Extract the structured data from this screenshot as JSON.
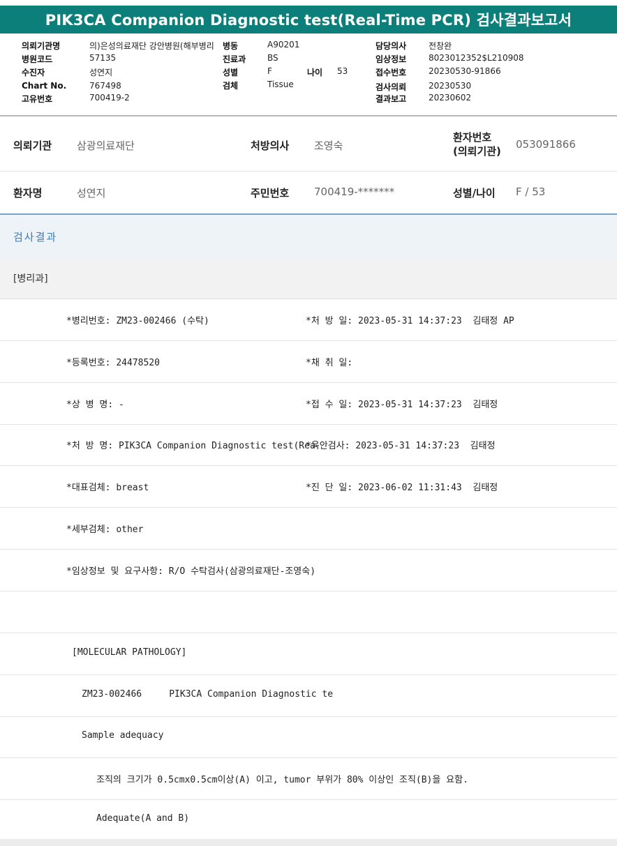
{
  "banner": {
    "title": "PIK3CA Companion Diagnostic test(Real-Time PCR) 검사결과보고서"
  },
  "header": {
    "labels": {
      "institution": "의뢰기관명",
      "hospital_code": "병원코드",
      "patient": "수진자",
      "chart_no": "Chart No.",
      "unique_no": "고유번호",
      "ward": "병동",
      "department": "진료과",
      "sex": "성별",
      "age": "나이",
      "specimen": "검체",
      "doctor": "담당의사",
      "clinical_info": "임상정보",
      "receipt_no": "접수번호",
      "request_date": "검사의뢰",
      "report_date": "결과보고"
    },
    "values": {
      "institution": "의)은성의료재단 강안병원(해부병리",
      "hospital_code": "57135",
      "patient": "성연지",
      "chart_no": "767498",
      "unique_no": "700419-2",
      "ward": "A90201",
      "department": "BS",
      "sex": "F",
      "age": "53",
      "specimen": "Tissue",
      "doctor": "전창완",
      "clinical_info": "8023012352$L210908",
      "receipt_no": "20230530-91866",
      "request_date": "20230530",
      "report_date": "20230602"
    }
  },
  "patient_info": {
    "row1": {
      "inst_label": "의뢰기관",
      "inst_value": "삼광의료재단",
      "doctor_label": "처방의사",
      "doctor_value": "조영숙",
      "pid_label_1": "환자번호",
      "pid_label_2": "(의뢰기관)",
      "pid_value": "053091866"
    },
    "row2": {
      "name_label": "환자명",
      "name_value": "성연지",
      "rrn_label": "주민번호",
      "rrn_value": "700419-*******",
      "sexage_label": "성별/나이",
      "sexage_value": "F / 53"
    }
  },
  "results": {
    "section_title": "검사결과",
    "department": "[병리과]",
    "rows": [
      {
        "left": "*병리번호: ZM23-002466 (수탁)",
        "right": "*처 방 일: 2023-05-31 14:37:23  김태정 AP"
      },
      {
        "left": "*등록번호: 24478520",
        "right": "*채 취 일:"
      },
      {
        "left": "*상 병 명: -",
        "right": "*접 수 일: 2023-05-31 14:37:23  김태정"
      },
      {
        "left": "*처 방 명: PIK3CA Companion Diagnostic test(Rea",
        "right": "*육안검사: 2023-05-31 14:37:23  김태정"
      },
      {
        "left": "*대표검체: breast",
        "right": "*진 단 일: 2023-06-02 11:31:43  김태정"
      },
      {
        "left": "*세부검체: other",
        "right": ""
      },
      {
        "left": "*임상정보 및 요구사항: R/O 수탁검사(삼광의료재단-조영숙)",
        "right": ""
      }
    ],
    "molecular": {
      "heading": "[MOLECULAR PATHOLOGY]",
      "case_line": "ZM23-002466     PIK3CA Companion Diagnostic te",
      "adequacy_label": "Sample adequacy",
      "criteria": "조직의 크기가 0.5cmx0.5cm이상(A) 이고, tumor 부위가 80% 이상인 조직(B)을 요함.",
      "result": "Adequate(A and B)"
    }
  }
}
